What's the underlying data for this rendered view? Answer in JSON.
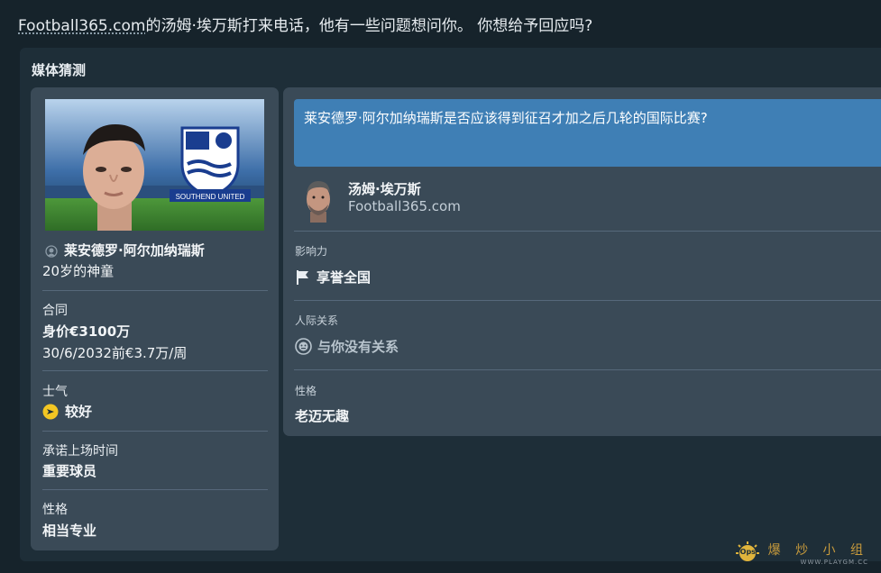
{
  "header": {
    "outlet_link": "Football365.com",
    "message": "的汤姆·埃万斯打来电话，他有一些问题想问你。 你想给予回应吗?"
  },
  "panel": {
    "title": "媒体猜测"
  },
  "player": {
    "name": "莱安德罗·阿尔加纳瑞斯",
    "subtitle": "20岁的神童",
    "club_badge_text": "SOUTHEND UNITED",
    "contract_label": "合同",
    "value": "身价€3100万",
    "contract_detail": "30/6/2032前€3.7万/周",
    "morale_label": "士气",
    "morale_value": "较好",
    "promised_time_label": "承诺上场时间",
    "promised_time_value": "重要球员",
    "personality_label": "性格",
    "personality_value": "相当专业"
  },
  "question": {
    "text": "莱安德罗·阿尔加纳瑞斯是否应该得到征召才加之后几轮的国际比赛?"
  },
  "journalist": {
    "name": "汤姆·埃万斯",
    "outlet": "Football365.com",
    "influence_label": "影响力",
    "influence_value": "享誉全国",
    "relationship_label": "人际关系",
    "relationship_value": "与你没有关系",
    "personality_label": "性格",
    "personality_value": "老迈无趣"
  },
  "watermark": {
    "text": "爆 炒 小 组",
    "url": "WWW.PLAYGM.CC",
    "badge": "Ops"
  },
  "colors": {
    "background": "#16232b",
    "panel": "#1e2e38",
    "card": "#3a4a57",
    "question_box": "#3f7fb5",
    "morale_icon": "#f3c623"
  },
  "icons": {
    "player_icon": "person-icon",
    "morale_icon": "arrow-right-circle-icon",
    "influence_icon": "flag-icon",
    "relationship_icon": "neutral-face-icon"
  }
}
